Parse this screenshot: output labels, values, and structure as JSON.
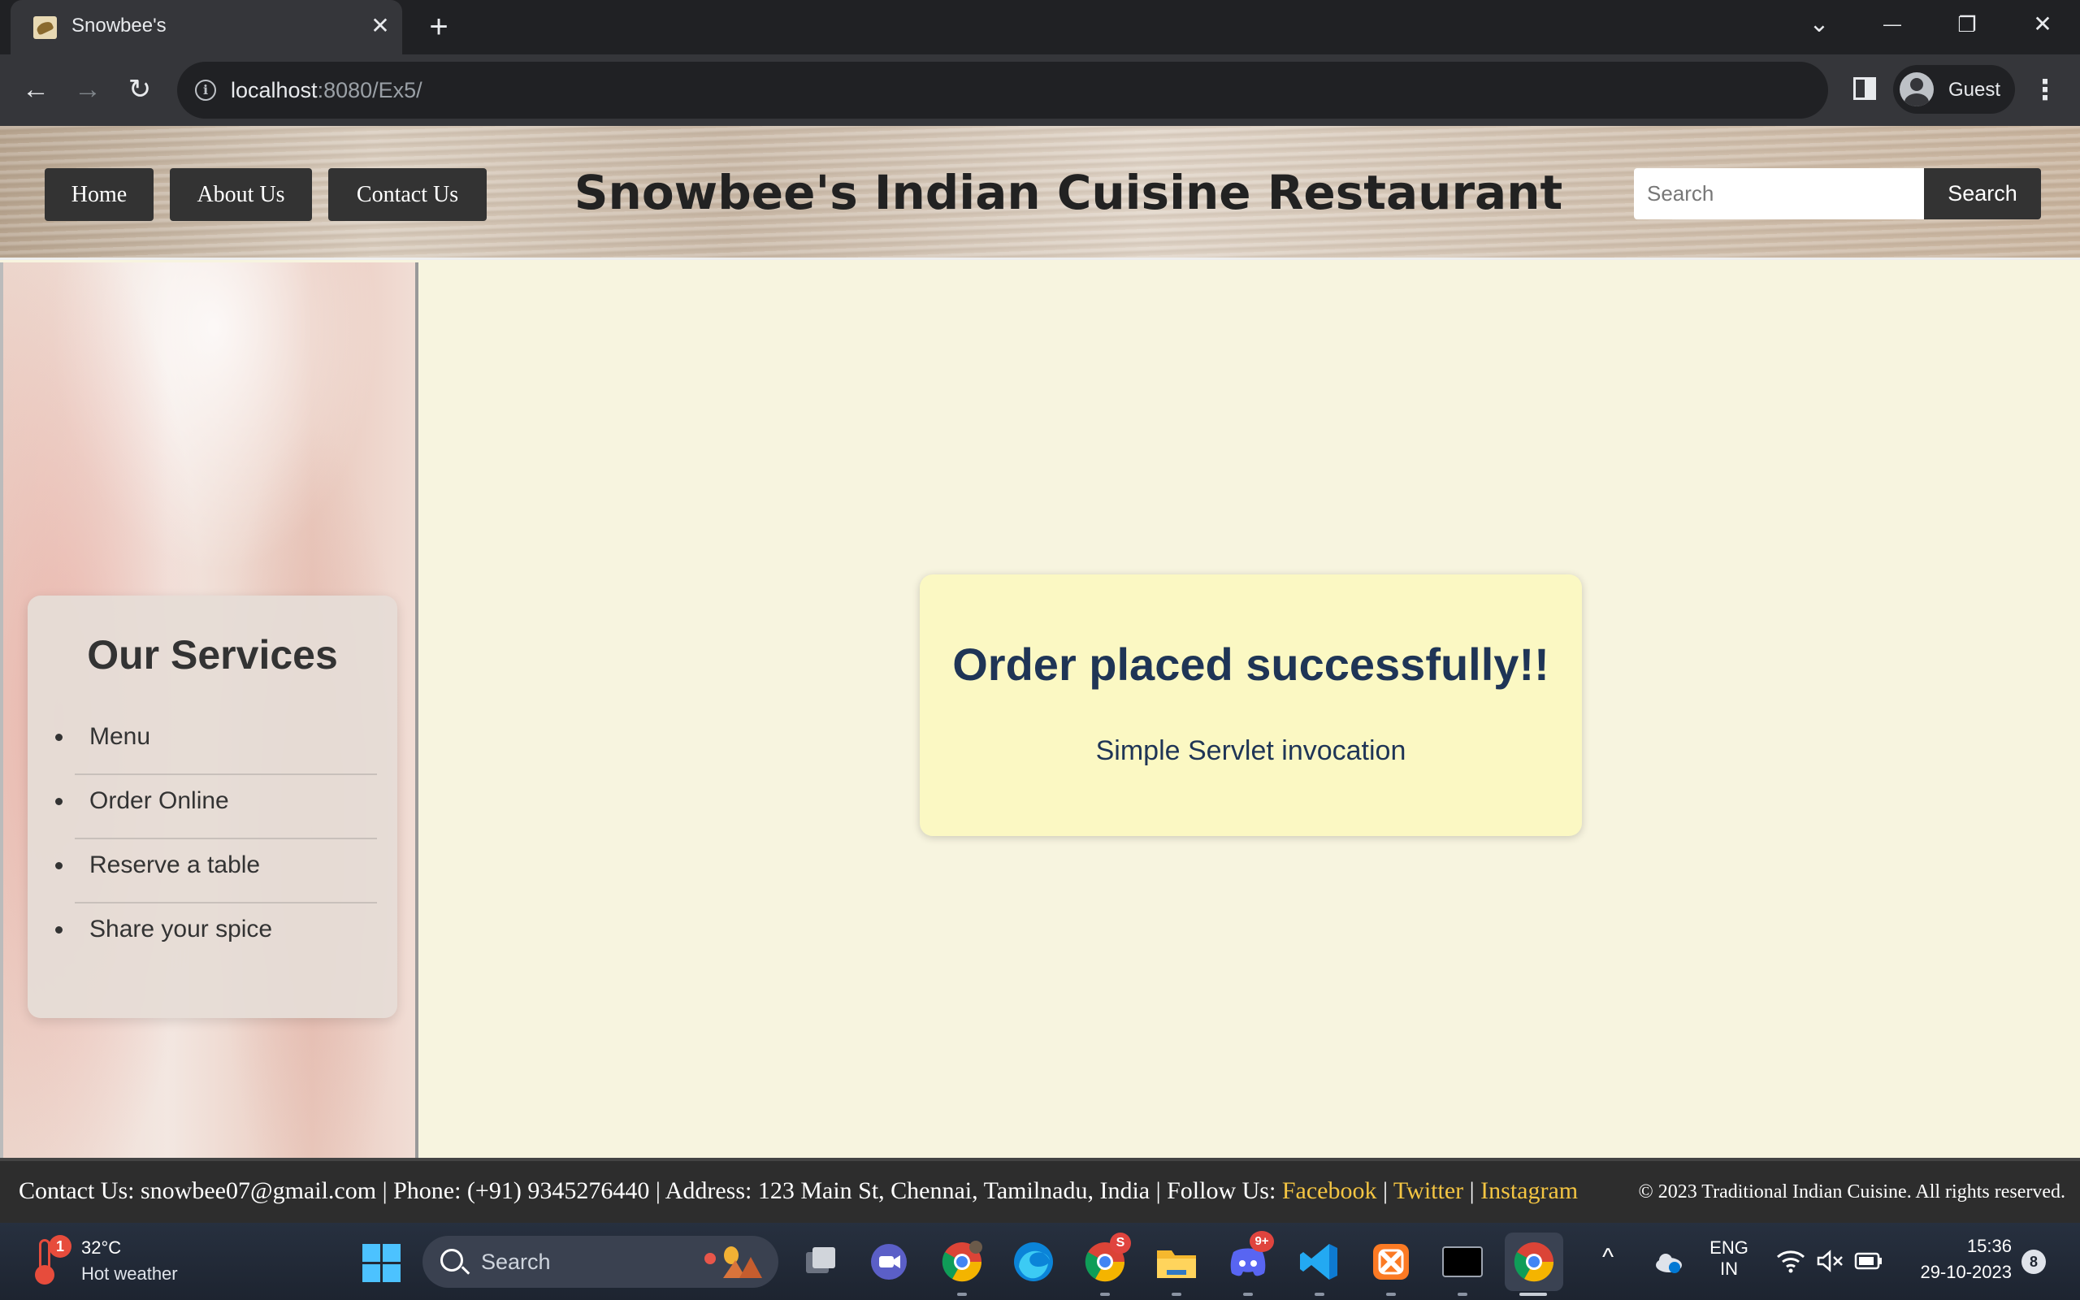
{
  "browser": {
    "tab_title": "Snowbee's",
    "tab_close": "✕",
    "new_tab": "+",
    "url_host": "localhost",
    "url_rest": ":8080/Ex5/",
    "profile_name": "Guest",
    "controls": {
      "tab_search": "⌄",
      "minimize": "—",
      "restore": "❐",
      "close": "✕",
      "back": "←",
      "forward": "→",
      "reload": "↻",
      "menu": "⋮",
      "info": "i"
    }
  },
  "header": {
    "nav": [
      "Home",
      "About Us",
      "Contact Us"
    ],
    "title": "Snowbee's Indian Cuisine Restaurant",
    "search_placeholder": "Search",
    "search_button": "Search"
  },
  "sidebar": {
    "title": "Our Services",
    "items": [
      "Menu",
      "Order Online",
      "Reserve a table",
      "Share your spice"
    ]
  },
  "main": {
    "heading": "Order placed successfully!!",
    "subtext": "Simple Servlet invocation"
  },
  "footer": {
    "contact_prefix": "Contact Us: ",
    "email": "snowbee07@gmail.com",
    "phone_text": " | Phone: (+91) 9345276440 | Address: 123 Main St, Chennai, Tamilnadu, India | Follow Us: ",
    "links": [
      "Facebook",
      "Twitter",
      "Instagram"
    ],
    "separator": " | ",
    "copyright": "© 2023 Traditional Indian Cuisine. All rights reserved.",
    "link_color": "#f4c542"
  },
  "taskbar": {
    "weather_temp": "32°C",
    "weather_desc": "Hot weather",
    "weather_badge": "1",
    "search_label": "Search",
    "apps": [
      "task-view",
      "meet",
      "chrome-profile",
      "edge",
      "chrome-s",
      "file-explorer",
      "discord",
      "vscode",
      "xampp",
      "terminal",
      "chrome-active"
    ],
    "chrome_s_badge": "S",
    "discord_badge": "9+",
    "tray_chevron": "^",
    "language_line1": "ENG",
    "language_line2": "IN",
    "time": "15:36",
    "date": "29-10-2023",
    "notification_count": "8"
  },
  "colors": {
    "accent_dark": "#333333",
    "heading_blue": "#1f3556",
    "page_bg": "#f7f4df",
    "card_bg": "#fbf8c3"
  }
}
